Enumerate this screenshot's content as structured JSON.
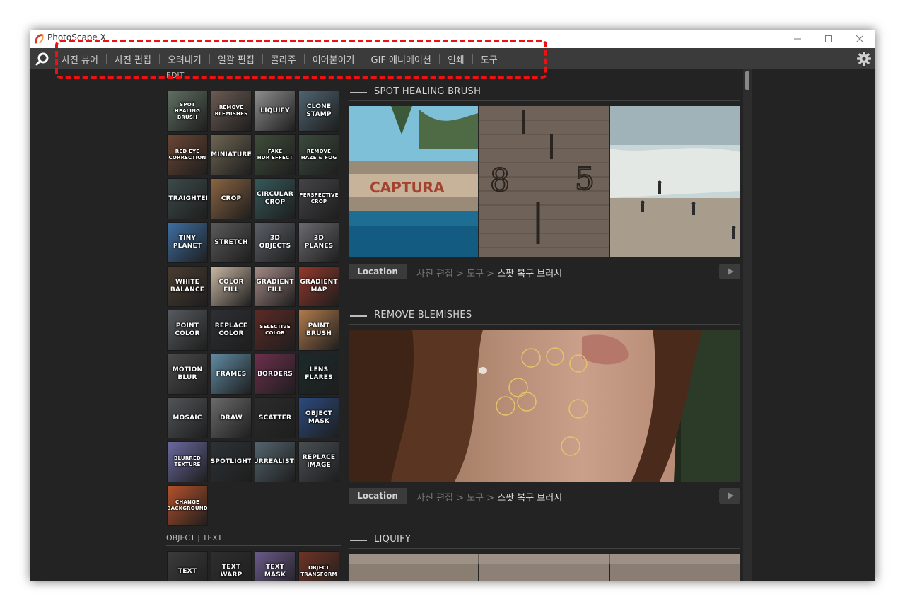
{
  "window": {
    "title": "PhotoScape X"
  },
  "menu": {
    "items": [
      "사진 뷰어",
      "사진 편집",
      "오려내기",
      "일괄 편집",
      "콜라주",
      "이어붙이기",
      "GIF 애니메이션",
      "인쇄",
      "도구"
    ]
  },
  "edit": {
    "label": "EDIT",
    "tools": [
      {
        "label": "SPOT\nHEALING\nBRUSH",
        "color": "#5f6f62"
      },
      {
        "label": "REMOVE\nBLEMISHES",
        "color": "#6a5a52"
      },
      {
        "label": "LIQUIFY",
        "color": "#8d8d8d"
      },
      {
        "label": "CLONE\nSTAMP",
        "color": "#4e6470"
      },
      {
        "label": "RED EYE\nCORRECTION",
        "color": "#6b4634"
      },
      {
        "label": "MINIATURE",
        "color": "#6e6452"
      },
      {
        "label": "FAKE\nHDR EFFECT",
        "color": "#3f4d3a"
      },
      {
        "label": "REMOVE\nHAZE & FOG",
        "color": "#3b4a3c"
      },
      {
        "label": "STRAIGHTEN",
        "color": "#3d4a4a"
      },
      {
        "label": "CROP",
        "color": "#8a6440"
      },
      {
        "label": "CIRCULAR\nCROP",
        "color": "#36595a"
      },
      {
        "label": "PERSPECTIVE\nCROP",
        "color": "#444448"
      },
      {
        "label": "TINY\nPLANET",
        "color": "#3e6fa2"
      },
      {
        "label": "STRETCH",
        "color": "#5a5a5a"
      },
      {
        "label": "3D\nOBJECTS",
        "color": "#5b5f66"
      },
      {
        "label": "3D\nPLANES",
        "color": "#6b6b70"
      },
      {
        "label": "WHITE\nBALANCE",
        "color": "#4a3d30"
      },
      {
        "label": "COLOR\nFILL",
        "color": "#c9b6a3"
      },
      {
        "label": "GRADIENT\nFILL",
        "color": "#a48a86"
      },
      {
        "label": "GRADIENT\nMAP",
        "color": "#93382a"
      },
      {
        "label": "POINT\nCOLOR",
        "color": "#575a5e"
      },
      {
        "label": "REPLACE\nCOLOR",
        "color": "#2d2f33"
      },
      {
        "label": "SELECTIVE\nCOLOR",
        "color": "#5c2a25"
      },
      {
        "label": "PAINT\nBRUSH",
        "color": "#b07a4c"
      },
      {
        "label": "MOTION\nBLUR",
        "color": "#4a4a4a"
      },
      {
        "label": "FRAMES",
        "color": "#5f8aa1"
      },
      {
        "label": "BORDERS",
        "color": "#6c2f4c"
      },
      {
        "label": "LENS\nFLARES",
        "color": "#1b2a2a"
      },
      {
        "label": "MOSAIC",
        "color": "#525558"
      },
      {
        "label": "DRAW",
        "color": "#6a6a6a"
      },
      {
        "label": "SCATTER",
        "color": "#2b2b2b"
      },
      {
        "label": "OBJECT\nMASK",
        "color": "#2b4a7e"
      },
      {
        "label": "BLURRED\nTEXTURE",
        "color": "#6b6aa0"
      },
      {
        "label": "SPOTLIGHT",
        "color": "#2d3236"
      },
      {
        "label": "SURREALISTIC",
        "color": "#53646d"
      },
      {
        "label": "REPLACE\nIMAGE",
        "color": "#4a4f54"
      },
      {
        "label": "CHANGE\nBACKGROUND",
        "color": "#b5522a"
      }
    ]
  },
  "object_text": {
    "label": "OBJECT | TEXT",
    "tools": [
      {
        "label": "TEXT",
        "color": "#3b3b3b"
      },
      {
        "label": "TEXT\nWARP",
        "color": "#2e2e2e"
      },
      {
        "label": "TEXT\nMASK",
        "color": "#6a5a8a"
      },
      {
        "label": "OBJECT\nTRANSFORM",
        "color": "#6e3424"
      }
    ]
  },
  "sections": [
    {
      "title": "SPOT HEALING BRUSH",
      "location_label": "Location",
      "path_prefix": "사진 편집 > 도구 > ",
      "path_target": "스팟 복구 브러시"
    },
    {
      "title": "REMOVE BLEMISHES",
      "location_label": "Location",
      "path_prefix": "사진 편집 > 도구 > ",
      "path_target": "스팟 복구 브러시"
    },
    {
      "title": "LIQUIFY"
    }
  ],
  "colors": {
    "accent_highlight": "#ee1111",
    "background": "#232323",
    "menubar": "#3b3b3b"
  }
}
